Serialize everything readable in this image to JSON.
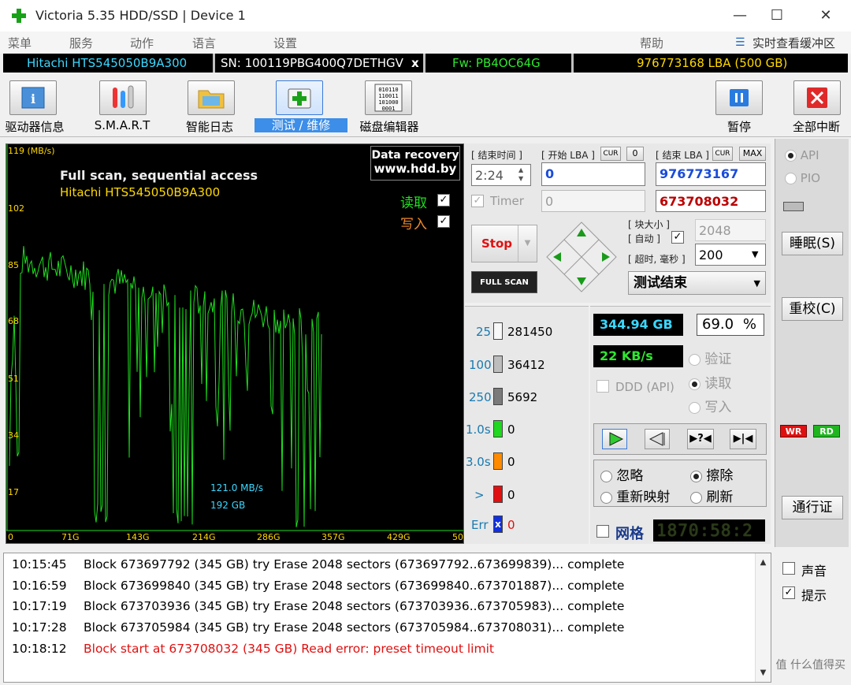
{
  "window": {
    "title": "Victoria 5.35 HDD/SSD | Device 1",
    "minimize": "—",
    "maximize": "☐",
    "close": "✕"
  },
  "menu": {
    "items": [
      "菜单",
      "服务",
      "动作",
      "语言",
      "设置"
    ],
    "help": "帮助",
    "live_buffer": "实时查看缓冲区"
  },
  "device": {
    "model": "Hitachi HTS545050B9A300",
    "serial": "SN: 100119PBG400Q7DETHGV",
    "x": "x",
    "firmware": "Fw: PB4OC64G",
    "capacity": "976773168 LBA (500 GB)"
  },
  "toolbar": {
    "driveinfo": "驱动器信息",
    "smart": "S.M.A.R.T",
    "log": "智能日志",
    "test": "测试 / 维修",
    "editor": "磁盘编辑器",
    "pause": "暂停",
    "abort": "全部中断"
  },
  "graph": {
    "ymax": "119 (MB/s)",
    "y_ticks": [
      "102",
      "85",
      "68",
      "51",
      "34",
      "17",
      "0"
    ],
    "x_ticks": [
      "71G",
      "143G",
      "214G",
      "286G",
      "357G",
      "429G",
      "50"
    ],
    "title": "Full scan, sequential access",
    "subtitle": "Hitachi HTS545050B9A300",
    "badge1": "Data recovery",
    "badge2": "www.hdd.by",
    "read": "读取",
    "write": "写入",
    "speed": "121.0 MB/s",
    "pos": "192 GB"
  },
  "controls": {
    "end_time_label": "[ 结束时间 ]",
    "start_lba_label": "[ 开始 LBA ]",
    "cur": "CUR",
    "zero": "0",
    "end_lba_label": "[ 结束 LBA ]",
    "max": "MAX",
    "time": "2:24",
    "start_lba": "0",
    "end_lba": "976773167",
    "timer": "Timer",
    "timer_val": "0",
    "cur_lba": "673708032",
    "stop": "Stop",
    "full_scan": "FULL SCAN",
    "block_size": "[ 块大小 ]",
    "auto": "[ 自动 ]",
    "timeout": "[ 超时, 毫秒 ]",
    "block_val": "2048",
    "timeout_val": "200",
    "status": "测试结束"
  },
  "stats": {
    "rows": [
      {
        "label": "25",
        "count": "281450",
        "color": "#f8f8f8"
      },
      {
        "label": "100",
        "count": "36412",
        "color": "#bdbdbd"
      },
      {
        "label": "250",
        "count": "5692",
        "color": "#7a7a7a"
      },
      {
        "label": "1.0s",
        "count": "0",
        "color": "#1fd81f"
      },
      {
        "label": "3.0s",
        "count": "0",
        "color": "#ff8a00"
      },
      {
        "label": ">",
        "count": "0",
        "color": "#e01010"
      },
      {
        "label": "Err",
        "count": "0",
        "color": "#1030e0"
      }
    ]
  },
  "progress": {
    "done": "344.94 GB",
    "percent": "69.0",
    "pct_sign": "%",
    "speed": "22 KB/s",
    "ddd": "DDD (API)",
    "verify": "验证",
    "read": "读取",
    "write": "写入",
    "ignore": "忽略",
    "erase": "擦除",
    "remap": "重新映射",
    "refresh": "刷新",
    "grid": "网格",
    "timer_display": "1870:58:2"
  },
  "right": {
    "api": "API",
    "pio": "PIO",
    "sleep": "睡眠(S)",
    "recal": "重校(C)",
    "passport": "通行证",
    "wr": "WR",
    "rd": "RD",
    "sound": "声音",
    "hints": "提示"
  },
  "log": [
    {
      "time": "10:15:45",
      "msg": "Block 673697792 (345 GB) try Erase 2048 sectors (673697792..673699839)... complete",
      "error": false
    },
    {
      "time": "10:16:59",
      "msg": "Block 673699840 (345 GB) try Erase 2048 sectors (673699840..673701887)... complete",
      "error": false
    },
    {
      "time": "10:17:19",
      "msg": "Block 673703936 (345 GB) try Erase 2048 sectors (673703936..673705983)... complete",
      "error": false
    },
    {
      "time": "10:17:28",
      "msg": "Block 673705984 (345 GB) try Erase 2048 sectors (673705984..673708031)... complete",
      "error": false
    },
    {
      "time": "10:18:12",
      "msg": "Block start at 673708032 (345 GB) Read error: preset timeout limit",
      "error": true
    }
  ],
  "watermark": "值 什么值得买"
}
